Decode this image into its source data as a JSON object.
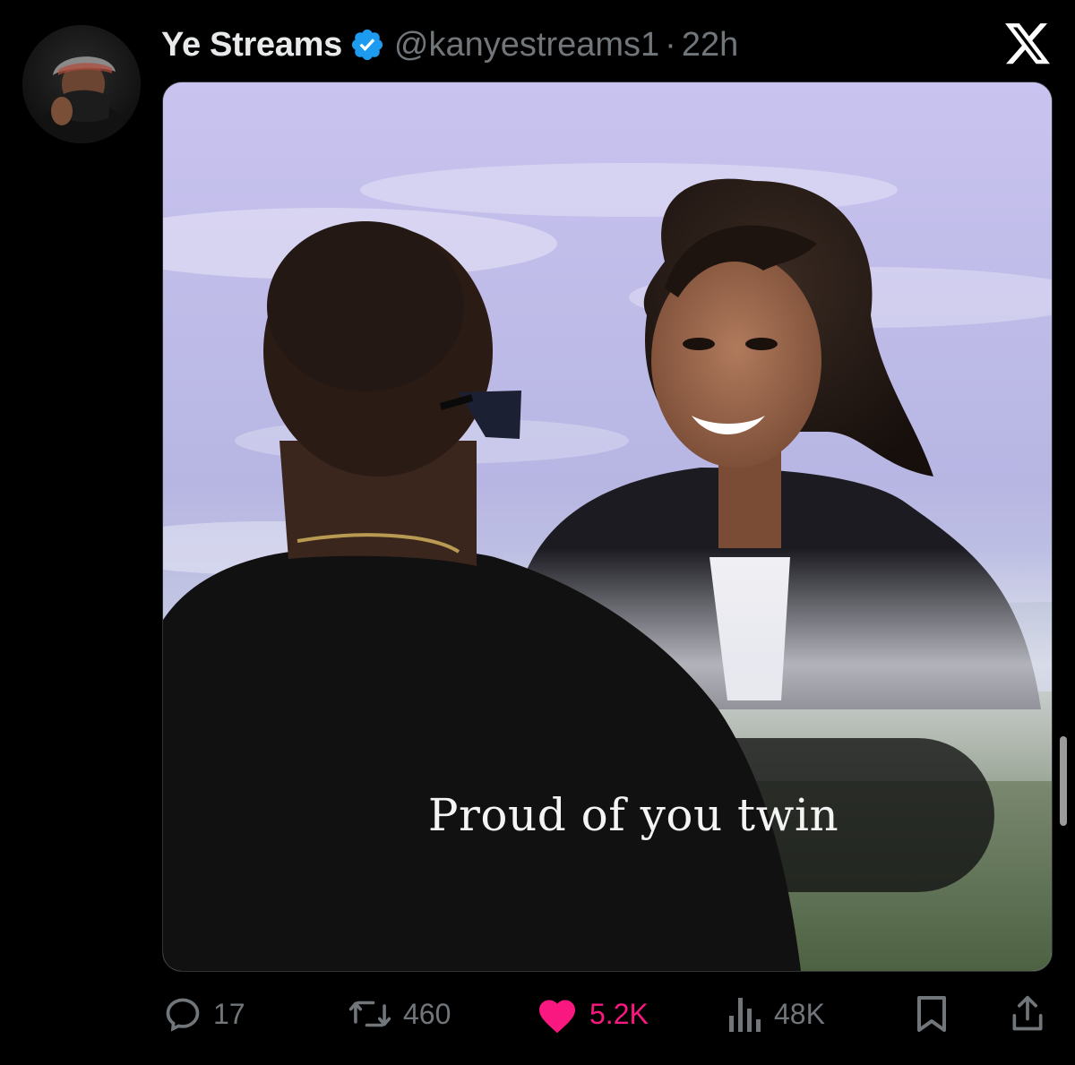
{
  "post": {
    "author": {
      "display_name": "Ye Streams",
      "handle": "@kanyestreams1",
      "separator": "·",
      "time": "22h"
    },
    "media": {
      "caption": "Proud of you twin"
    },
    "stats": {
      "replies": "17",
      "reposts": "460",
      "likes": "5.2K",
      "views": "48K"
    }
  },
  "icons": {
    "platform": "x-logo-icon",
    "verified": "verified-badge-icon",
    "reply": "reply-icon",
    "repost": "repost-icon",
    "like": "heart-icon",
    "views": "views-icon",
    "bookmark": "bookmark-icon",
    "share": "share-icon"
  },
  "colors": {
    "background": "#000000",
    "primary_text": "#e7e9ea",
    "secondary_text": "#71767b",
    "verified_blue": "#1d9bf0",
    "like_pink": "#f91880"
  }
}
